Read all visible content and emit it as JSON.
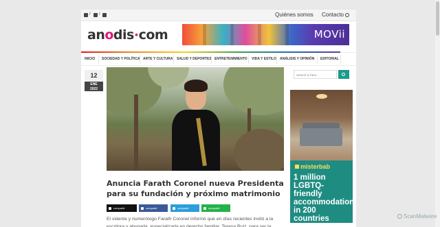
{
  "topbar": {
    "social": [
      {
        "icon": "youtube-icon"
      },
      {
        "icon": "facebook-icon"
      },
      {
        "icon": "twitter-icon"
      }
    ],
    "sep": "/",
    "links": [
      "Quiénes somos",
      "Contacto"
    ]
  },
  "logo": {
    "left": "an",
    "middle": "dis",
    "dot": "·",
    "right": "com",
    "o": "o"
  },
  "banner": {
    "brand": "MOVii"
  },
  "nav": {
    "items": [
      "INICIO",
      "SOCIEDAD Y POLÍTICA",
      "ARTE Y CULTURA",
      "SALUD Y DEPORTES",
      "ENTRETENIMIENTO",
      "VIDA Y ESTILO",
      "ANÁLISIS Y OPINIÓN",
      "EDITORIAL"
    ]
  },
  "date": {
    "day": "12",
    "month": "ENE",
    "year": "2022"
  },
  "search": {
    "placeholder": "Search in here..."
  },
  "ad": {
    "brand": "misterbab",
    "text": "1 million LGBTQ-friendly accommodations in 200 countries"
  },
  "article": {
    "title": "Anuncia Farath Coronel nueva Presidenta para su fundación y próximo matrimonio",
    "share": [
      {
        "label": "compartir",
        "color": "#111111",
        "icon": "x-icon"
      },
      {
        "label": "compartir",
        "color": "#3b5998",
        "icon": "facebook-icon"
      },
      {
        "label": "compartir",
        "color": "#2c9ed8",
        "icon": "telegram-icon"
      },
      {
        "label": "compartir",
        "color": "#25b14a",
        "icon": "whatsapp-icon"
      }
    ],
    "body": "El vidente y numerólogo Farath Coronel informó que en días recientes invitó a la escritora y abogada, especializada en derecho familiar, Teresa Ruiz, para ser la Presidenta"
  },
  "watermark": "ScanMalware"
}
